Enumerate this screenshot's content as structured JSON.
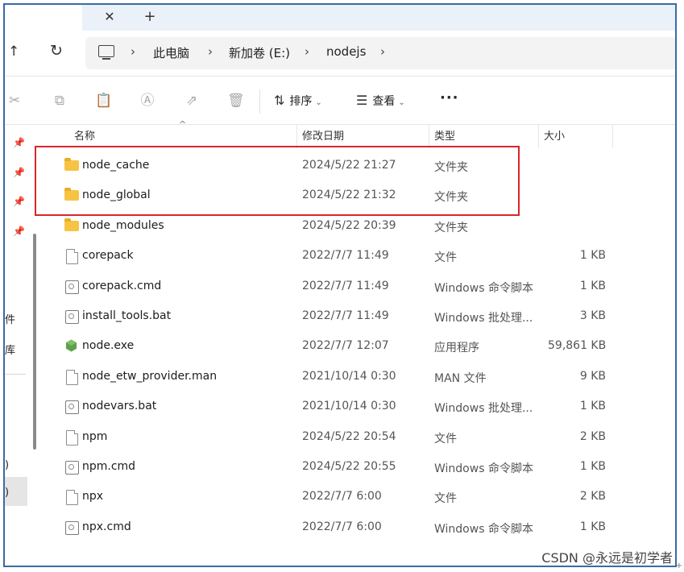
{
  "window": {
    "tab_close_symbol": "✕",
    "tab_new_symbol": "+"
  },
  "nav": {
    "up_symbol": "↑",
    "refresh_symbol": "↻",
    "breadcrumb": [
      "此电脑",
      "新加卷 (E:)",
      "nodejs"
    ],
    "separator": "›"
  },
  "toolbar": {
    "sort_label": "排序",
    "view_label": "查看",
    "more_label": "···"
  },
  "leftnav": {
    "partial_labels": [
      "件",
      "库",
      ")",
      ")"
    ]
  },
  "columns": {
    "name": "名称",
    "modified": "修改日期",
    "type": "类型",
    "size": "大小"
  },
  "files": [
    {
      "name": "node_cache",
      "modified": "2024/5/22 21:27",
      "type": "文件夹",
      "size": "",
      "icon": "folder-icon"
    },
    {
      "name": "node_global",
      "modified": "2024/5/22 21:32",
      "type": "文件夹",
      "size": "",
      "icon": "folder-icon"
    },
    {
      "name": "node_modules",
      "modified": "2024/5/22 20:39",
      "type": "文件夹",
      "size": "",
      "icon": "folder-icon"
    },
    {
      "name": "corepack",
      "modified": "2022/7/7 11:49",
      "type": "文件",
      "size": "1 KB",
      "icon": "file-icon"
    },
    {
      "name": "corepack.cmd",
      "modified": "2022/7/7 11:49",
      "type": "Windows 命令脚本",
      "size": "1 KB",
      "icon": "script-icon"
    },
    {
      "name": "install_tools.bat",
      "modified": "2022/7/7 11:49",
      "type": "Windows 批处理...",
      "size": "3 KB",
      "icon": "script-icon"
    },
    {
      "name": "node.exe",
      "modified": "2022/7/7 12:07",
      "type": "应用程序",
      "size": "59,861 KB",
      "icon": "node-exe-icon"
    },
    {
      "name": "node_etw_provider.man",
      "modified": "2021/10/14 0:30",
      "type": "MAN 文件",
      "size": "9 KB",
      "icon": "file-icon"
    },
    {
      "name": "nodevars.bat",
      "modified": "2021/10/14 0:30",
      "type": "Windows 批处理...",
      "size": "1 KB",
      "icon": "script-icon"
    },
    {
      "name": "npm",
      "modified": "2024/5/22 20:54",
      "type": "文件",
      "size": "2 KB",
      "icon": "file-icon"
    },
    {
      "name": "npm.cmd",
      "modified": "2024/5/22 20:55",
      "type": "Windows 命令脚本",
      "size": "1 KB",
      "icon": "script-icon"
    },
    {
      "name": "npx",
      "modified": "2022/7/7 6:00",
      "type": "文件",
      "size": "2 KB",
      "icon": "file-icon"
    },
    {
      "name": "npx.cmd",
      "modified": "2022/7/7 6:00",
      "type": "Windows 命令脚本",
      "size": "1 KB",
      "icon": "script-icon"
    }
  ],
  "watermark": "CSDN @永远是初学者",
  "colors": {
    "highlight_border": "#d9262c",
    "frame_border": "#3b6aa3"
  }
}
